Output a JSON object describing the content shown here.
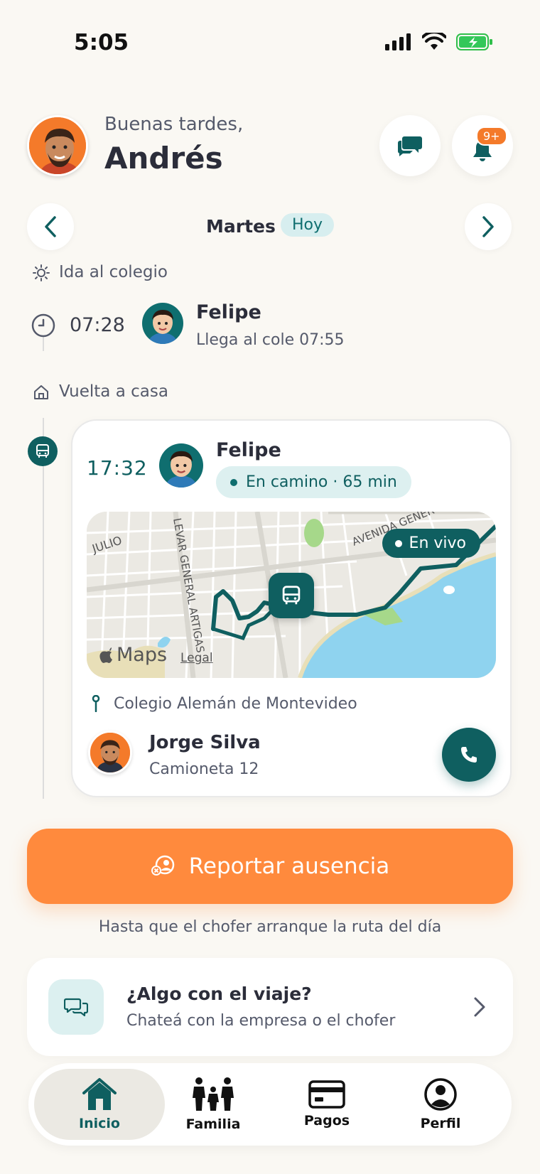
{
  "status_bar": {
    "time": "5:05"
  },
  "header": {
    "greeting": "Buenas tardes,",
    "user_name": "Andrés",
    "notification_badge": "9+"
  },
  "day_selector": {
    "day": "Martes",
    "today_label": "Hoy"
  },
  "morning": {
    "section_label": "Ida al colegio",
    "time": "07:28",
    "child_name": "Felipe",
    "arrival_text": "Llega al cole 07:55"
  },
  "return": {
    "section_label": "Vuelta a casa",
    "time": "17:32",
    "child_name": "Felipe",
    "status_text": "En camino · 65 min",
    "live_label": "En vivo",
    "map": {
      "street_labels": [
        "JULIO",
        "LEVAR GENERAL ARTIGAS",
        "AVENIDA GENER"
      ],
      "maps_label": "Maps",
      "legal_label": "Legal"
    },
    "destination": "Colegio Alemán de Montevideo",
    "driver_name": "Jorge Silva",
    "vehicle": "Camioneta 12"
  },
  "report": {
    "button_label": "Reportar ausencia",
    "note": "Hasta que el chofer arranque la ruta del día"
  },
  "help": {
    "title": "¿Algo con el viaje?",
    "subtitle": "Chateá con la empresa o el chofer"
  },
  "tabbar": {
    "tabs": [
      {
        "label": "Inicio",
        "icon": "home-icon",
        "active": true
      },
      {
        "label": "Familia",
        "icon": "family-icon",
        "active": false
      },
      {
        "label": "Pagos",
        "icon": "card-icon",
        "active": false
      },
      {
        "label": "Perfil",
        "icon": "profile-icon",
        "active": false
      }
    ]
  },
  "colors": {
    "accent": "#0f5f60",
    "orange": "#ff8a3d",
    "background": "#faf8f3"
  }
}
